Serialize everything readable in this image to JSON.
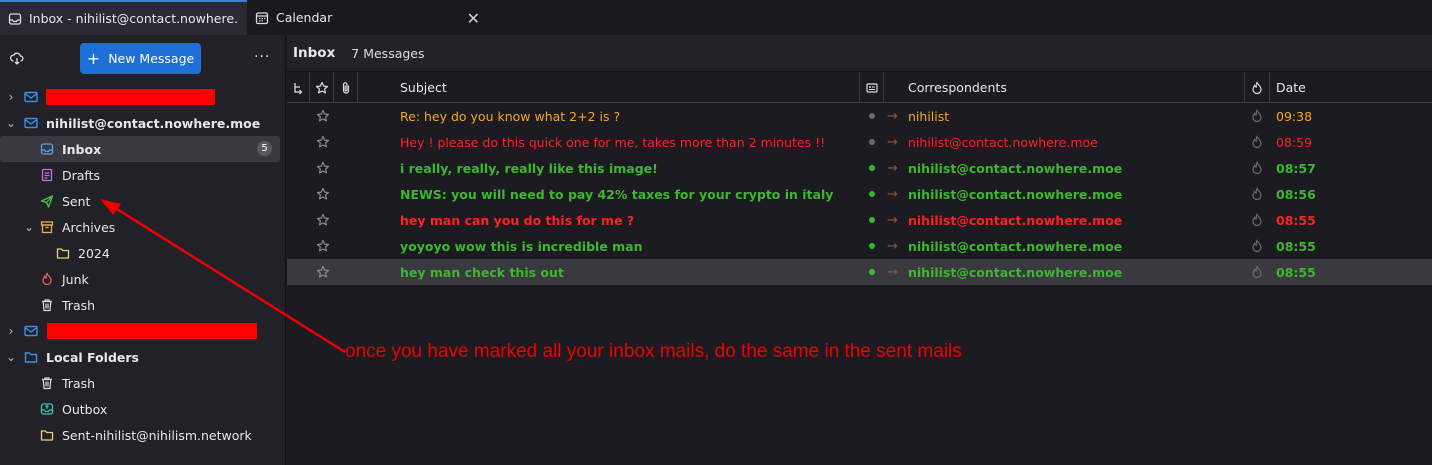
{
  "tabs": [
    {
      "label": "Inbox - nihilist@contact.nowhere.moe",
      "icon": "inbox-icon",
      "active": true
    },
    {
      "label": "Calendar",
      "icon": "calendar-icon",
      "active": false
    }
  ],
  "sidebar": {
    "new_message_label": "New Message",
    "more_label": "···",
    "account_main": "nihilist@contact.nowhere.moe",
    "folders": {
      "inbox": "Inbox",
      "inbox_count": "5",
      "drafts": "Drafts",
      "sent": "Sent",
      "archives": "Archives",
      "year": "2024",
      "junk": "Junk",
      "trash": "Trash"
    },
    "local_folders": "Local Folders",
    "local": {
      "trash": "Trash",
      "outbox": "Outbox",
      "sent_other": "Sent-nihilist@nihilism.network"
    }
  },
  "main": {
    "title": "Inbox",
    "count": "7 Messages",
    "columns": {
      "subject": "Subject",
      "correspondents": "Correspondents",
      "date": "Date"
    },
    "messages": [
      {
        "subject": "Re: hey do you know what 2+2 is ?",
        "from": "nihilist",
        "date": "09:38",
        "color": "orange",
        "bold": false,
        "read": true
      },
      {
        "subject": "Hey ! please do this quick one for me, takes more than 2 minutes !!",
        "from": "nihilist@contact.nowhere.moe",
        "date": "08:59",
        "color": "red",
        "bold": false,
        "read": true
      },
      {
        "subject": "i really, really, really like this image!",
        "from": "nihilist@contact.nowhere.moe",
        "date": "08:57",
        "color": "green",
        "bold": true,
        "read": false
      },
      {
        "subject": "NEWS: you will need to pay 42% taxes for your crypto in italy",
        "from": "nihilist@contact.nowhere.moe",
        "date": "08:56",
        "color": "green",
        "bold": true,
        "read": false
      },
      {
        "subject": "hey man can you do this for me ?",
        "from": "nihilist@contact.nowhere.moe",
        "date": "08:55",
        "color": "red",
        "bold": true,
        "read": false
      },
      {
        "subject": "yoyoyo wow this is incredible man",
        "from": "nihilist@contact.nowhere.moe",
        "date": "08:55",
        "color": "green",
        "bold": true,
        "read": false
      },
      {
        "subject": "hey man check this out",
        "from": "nihilist@contact.nowhere.moe",
        "date": "08:55",
        "color": "green",
        "bold": true,
        "read": false,
        "selected": true
      }
    ]
  },
  "annotation": {
    "text": "once you have marked all your inbox mails, do the same in the sent mails",
    "color": "#ee0000"
  },
  "colors": {
    "orange": "#f5a623",
    "red": "#ff2020",
    "green": "#3bb82c",
    "accent": "#1f6fd8",
    "redaction": "#ff0000"
  }
}
